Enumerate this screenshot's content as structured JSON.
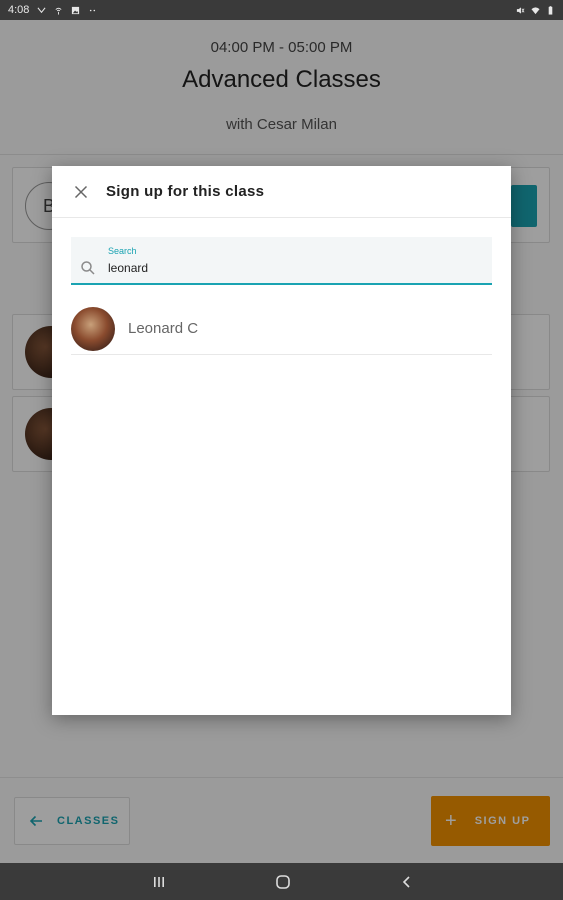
{
  "status_bar": {
    "time": "4:08"
  },
  "page": {
    "time_range": "04:00 PM - 05:00 PM",
    "class_title": "Advanced Classes",
    "instructor": "with Cesar Milan",
    "top_card_avatar_initial": "B",
    "classes_button_label": "CLASSES",
    "signup_button_label": "SIGN UP",
    "signup_button_plus": "+"
  },
  "dialog": {
    "title": "Sign up for this class",
    "search": {
      "label": "Search",
      "value": "leonard"
    },
    "results": [
      {
        "name": "Leonard C"
      }
    ]
  },
  "colors": {
    "accent": "#1aa3b2",
    "signup": "#f39200"
  }
}
